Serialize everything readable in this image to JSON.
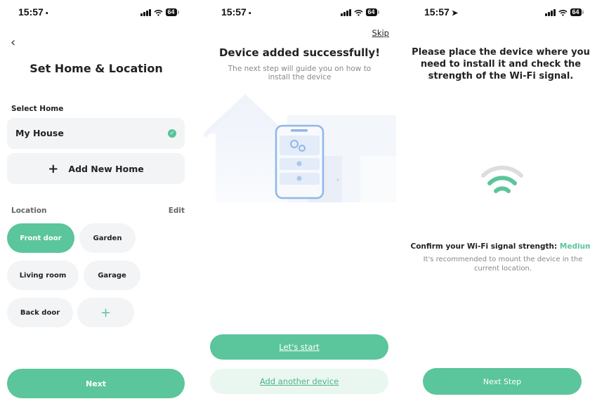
{
  "screens": {
    "s1": {
      "status": {
        "time": "15:57",
        "battery": "64"
      },
      "title": "Set Home & Location",
      "select_home_label": "Select Home",
      "home_name": "My House",
      "add_home_label": "Add New Home",
      "location_label": "Location",
      "edit_label": "Edit",
      "locations": [
        "Front door",
        "Garden",
        "Living room",
        "Garage",
        "Back door"
      ],
      "selected_location": "Front door",
      "next_label": "Next"
    },
    "s2": {
      "status": {
        "time": "15:57",
        "battery": "64"
      },
      "skip_label": "Skip",
      "title": "Device added successfully!",
      "subtitle": "The next step will guide you on how to install the device",
      "start_label": "Let's start",
      "add_another_label": "Add another device"
    },
    "s3": {
      "status": {
        "time": "15:57",
        "battery": "64"
      },
      "title": "Please place the device where you need to install it and check the strength of the Wi-Fi signal.",
      "confirm_text": "Confirm your Wi-Fi signal strength:",
      "signal_value": "Medium",
      "note": "It's recommended to mount the device in the current location.",
      "next_step_label": "Next Step"
    }
  },
  "colors": {
    "accent": "#5bc59b",
    "chip_bg": "#f3f4f6",
    "secondary_btn_bg": "#eaf7f1",
    "wifi_inactive": "#dddddd"
  },
  "icons": {
    "back": "chevron-left-icon",
    "check": "check-circle-icon",
    "add": "plus-icon",
    "wifi": "wifi-icon",
    "signal": "cellular-signal-icon",
    "battery": "battery-icon",
    "location_arrow": "location-arrow-icon"
  }
}
